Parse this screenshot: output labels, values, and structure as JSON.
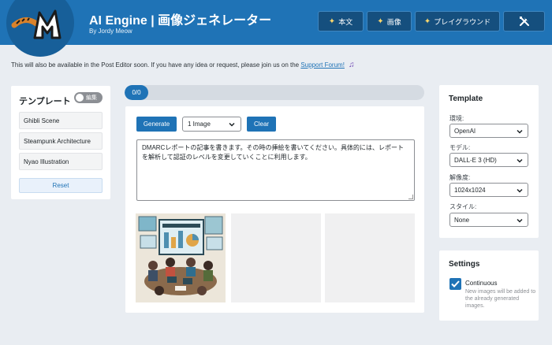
{
  "header": {
    "title": "AI Engine | 画像ジェネレーター",
    "byline": "By Jordy Meow",
    "buttons": [
      {
        "label": "本文",
        "icon": "sparkle-icon"
      },
      {
        "label": "画像",
        "icon": "sparkle-icon"
      },
      {
        "label": "プレイグラウンド",
        "icon": "sparkle-icon"
      },
      {
        "label": "",
        "icon": "tools-icon"
      }
    ]
  },
  "notice": {
    "text": "This will also be available in the Post Editor soon. If you have any idea or request, please join us on the",
    "link": "Support Forum!",
    "icon": "music-note-icon"
  },
  "templates": {
    "title": "テンプレート",
    "edit_toggle": "編集",
    "items": [
      {
        "label": "Ghibli Scene"
      },
      {
        "label": "Steampunk Architecture"
      },
      {
        "label": "Nyao Illustration"
      }
    ],
    "reset_label": "Reset"
  },
  "progress": {
    "label": "0/0",
    "value": 0
  },
  "generator": {
    "generate_label": "Generate",
    "count_value": "1 Image",
    "clear_label": "Clear",
    "prompt": "DMARCレポートの記事を書きます。その時の挿絵を書いてください。具体的には、レポートを解析して認証のレベルを変更していくことに利用します。"
  },
  "template_panel": {
    "title": "Template",
    "fields": [
      {
        "label": "環境:",
        "value": "OpenAI"
      },
      {
        "label": "モデル:",
        "value": "DALL-E 3 (HD)"
      },
      {
        "label": "解像度:",
        "value": "1024x1024"
      },
      {
        "label": "スタイル:",
        "value": "None"
      }
    ]
  },
  "settings": {
    "title": "Settings",
    "continuous_label": "Continuous",
    "continuous_checked": true,
    "continuous_help": "New images will be added to the already generated images."
  },
  "colors": {
    "brand": "#1f73b6",
    "header_button": "#154f7e",
    "background": "#e9edf2"
  }
}
